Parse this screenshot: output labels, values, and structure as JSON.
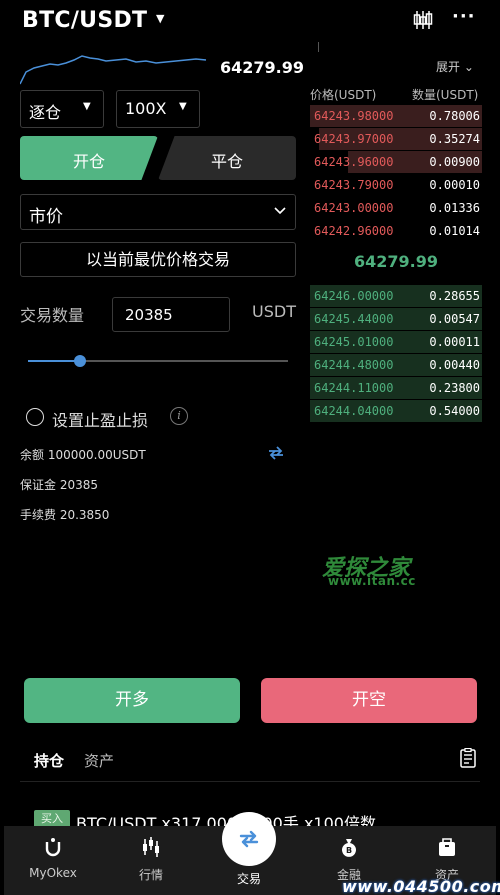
{
  "header": {
    "pair": "BTC/USDT",
    "icons": {
      "kline": "candlestick-icon",
      "more": "more-icon"
    },
    "more_label": "···"
  },
  "ticker": {
    "last_price": "64279.99"
  },
  "form": {
    "margin_mode": "逐仓",
    "leverage": "100X",
    "tab_open": "开仓",
    "tab_close": "平仓",
    "order_type": "市价",
    "best_price_btn": "以当前最优价格交易",
    "qty_label": "交易数量",
    "qty_value": "20385",
    "qty_unit": "USDT",
    "slider_percent": 20,
    "tpsl_label": "设置止盈止损",
    "info_icon": "i",
    "balance": "余额 100000.00USDT",
    "margin": "保证金 20385",
    "fee": "手续费 20.3850"
  },
  "orderbook": {
    "expand_label": "展开",
    "col_price": "价格(USDT)",
    "col_qty": "数量(USDT)",
    "asks": [
      {
        "price": "64243.98000",
        "qty": "0.78006",
        "depth": 1.0
      },
      {
        "price": "64243.97000",
        "qty": "0.35274",
        "depth": 0.95
      },
      {
        "price": "64243.96000",
        "qty": "0.00900",
        "depth": 0.78
      },
      {
        "price": "64243.79000",
        "qty": "0.00010",
        "depth": 0.0
      },
      {
        "price": "64243.00000",
        "qty": "0.01336",
        "depth": 0.0
      },
      {
        "price": "64242.96000",
        "qty": "0.01014",
        "depth": 0.0
      }
    ],
    "mid_price": "64279.99",
    "bids": [
      {
        "price": "64246.00000",
        "qty": "0.28655",
        "depth": 1.0
      },
      {
        "price": "64245.44000",
        "qty": "0.00547",
        "depth": 1.0
      },
      {
        "price": "64245.01000",
        "qty": "0.00011",
        "depth": 1.0
      },
      {
        "price": "64244.48000",
        "qty": "0.00440",
        "depth": 1.0
      },
      {
        "price": "64244.11000",
        "qty": "0.23800",
        "depth": 1.0
      },
      {
        "price": "64244.04000",
        "qty": "0.54000",
        "depth": 1.0
      }
    ]
  },
  "actions": {
    "long": "开多",
    "short": "开空"
  },
  "positions": {
    "tab_positions": "持仓",
    "tab_assets": "资产",
    "badge": "买入",
    "row_text": "BTC/USDT x317.0000 200手 x100倍数"
  },
  "nav": {
    "items": [
      {
        "label": "MyOkex",
        "icon": "myokex-icon"
      },
      {
        "label": "行情",
        "icon": "market-icon"
      },
      {
        "label": "交易",
        "icon": "trade-icon"
      },
      {
        "label": "金融",
        "icon": "finance-icon"
      },
      {
        "label": "资产",
        "icon": "assets-icon"
      }
    ]
  },
  "watermarks": {
    "site_cn": "爱探之家",
    "site_url": "www.itan.cc",
    "bottom": "www.044500.com"
  },
  "colors": {
    "green": "#52b583",
    "red": "#e9687a",
    "blue": "#4a90d9",
    "ask_text": "#e25a5a",
    "bid_text": "#4fb07e"
  }
}
